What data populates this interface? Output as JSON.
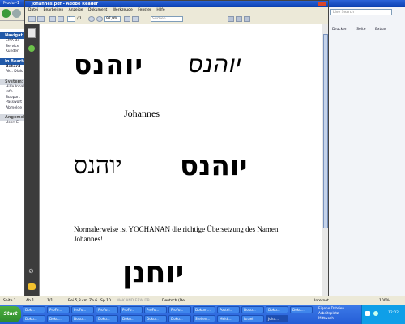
{
  "browser": {
    "title": "Modul-1",
    "search_placeholder": "Live Search",
    "right_tools": [
      "Drucken",
      "Seite",
      "Extras"
    ],
    "sidebar": {
      "nav_header": "Navigat",
      "nav_items": [
        "EMA Be",
        "Service",
        "Kunden"
      ],
      "edit_header": "In Bearb",
      "edit_items": [
        "Behörd",
        "Akt. Dialo"
      ],
      "system_header": "System:",
      "system_items": [
        "Hilfe Inhal",
        "Info",
        "Support",
        "Passwort",
        "Abmelde"
      ],
      "login_header": "Angemel",
      "login_items": [
        "User:   E"
      ]
    }
  },
  "acrobat": {
    "title": "Johannes.pdf - Adobe Reader",
    "menu": [
      "Datei",
      "Bearbeiten",
      "Anzeige",
      "Dokument",
      "Werkzeuge",
      "Fenster",
      "Hilfe"
    ],
    "page_current": "1",
    "page_total": "/ 1",
    "zoom": "97,9%",
    "search_placeholder": "Suchen"
  },
  "document": {
    "hebrew_1a": "יוהנס",
    "hebrew_1b": "יוהנס",
    "name": "Johannes",
    "hebrew_2a": "יוהנס",
    "hebrew_2b": "יוהנס",
    "sentence": "Normalerweise ist YOCHANAN die richtige Übersetzung des Namen Johannes!",
    "hebrew_3": "יוחנן"
  },
  "statusbar": {
    "seite": "Seite 1",
    "ab": "Ab 1",
    "count": "1/1",
    "bei": "Bei 5,8 cm",
    "ze": "Ze 6",
    "sp": "Sp 10",
    "modes": "MAK  AND  ERW  ÜB",
    "lang": "Deutsch (De",
    "internet": "Internet",
    "zoom": "100%"
  },
  "taskbar": {
    "start": "Start",
    "row1": [
      "Dok...",
      "ProFo...",
      "ProFo...",
      "ProFo...",
      "ProFo...",
      "ProFo...",
      "ProFo...",
      "Dokum...",
      "Postei...",
      "Doku...",
      "Doku...",
      "Doku..."
    ],
    "row2": [
      "Doku...",
      "Doku...",
      "Doku...",
      "Doku...",
      "Doku...",
      "Doku...",
      "Doku...",
      "Stellen...",
      "Meldt...",
      "Israel",
      "Joha..."
    ],
    "notify": [
      "Eigene Dateien",
      "Arbeitsplatz",
      "Mittwoch"
    ],
    "clock": "12:02"
  }
}
